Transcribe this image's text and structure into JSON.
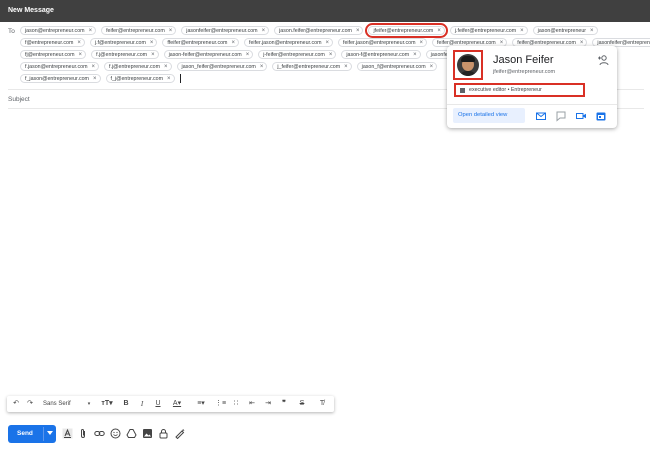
{
  "window": {
    "title": "New Message"
  },
  "compose": {
    "to_label": "To",
    "subject_placeholder": "Subject",
    "recipient_rows": [
      [
        "jason@entrepreneur.com",
        "feifer@entrepreneur.com",
        "jasonfeifer@entrepreneur.com",
        "jason.feifer@entrepreneur.com",
        "jfeifer@entrepreneur.com",
        "j.feifer@entrepreneur.com",
        "jason@entrepreneur"
      ],
      [
        "f@entrepreneur.com",
        "j.f@entrepreneur.com",
        "ffeifer@entrepreneur.com",
        "feifer.jason@entrepreneur.com",
        "feifer.jason@entrepreneur.com",
        "feifer@entrepreneur.com",
        "feifer@entrepreneur.com",
        "jasonfeifer@entrepreneur.com"
      ],
      [
        "fj@entrepreneur.com",
        "f.j@entrepreneur.com",
        "jason-feifer@entrepreneur.com",
        "j-feifer@entrepreneur.com",
        "jason-f@entrepreneur.com",
        "jasonfeifer@entrepreneur.com"
      ],
      [
        "f.jason@entrepreneur.com",
        "f.j@entrepreneur.com",
        "jason_feifer@entrepreneur.com",
        "j_feifer@entrepreneur.com",
        "jason_f@entrepreneur.com"
      ],
      [
        "f_jason@entrepreneur.com",
        "f_j@entrepreneur.com"
      ]
    ],
    "highlighted_recipient": "jfeifer@entrepreneur.com"
  },
  "contact_card": {
    "name": "Jason Feifer",
    "email": "jfeifer@entrepreneur.com",
    "role": "executive editor • Entrepreneur",
    "open_detailed_view": "Open detailed view",
    "icons": [
      "add-contact-icon",
      "building-icon",
      "email-icon",
      "chat-icon",
      "video-icon",
      "calendar-icon"
    ]
  },
  "formatting_toolbar": {
    "font": "Sans Serif",
    "icons": [
      "undo-icon",
      "redo-icon",
      "font-size-icon",
      "bold-icon",
      "italic-icon",
      "underline-icon",
      "text-color-icon",
      "align-icon",
      "numbered-list-icon",
      "bulleted-list-icon",
      "indent-less-icon",
      "indent-more-icon",
      "quote-icon",
      "strikethrough-icon",
      "remove-formatting-icon"
    ]
  },
  "bottom_toolbar": {
    "send_label": "Send",
    "icons": [
      "formatting-options-icon",
      "attach-icon",
      "link-icon",
      "emoji-icon",
      "drive-icon",
      "photo-icon",
      "confidential-icon",
      "signature-icon"
    ]
  },
  "colors": {
    "accent": "#1a73e8",
    "highlight": "#d93025",
    "titlebar": "#404040"
  }
}
